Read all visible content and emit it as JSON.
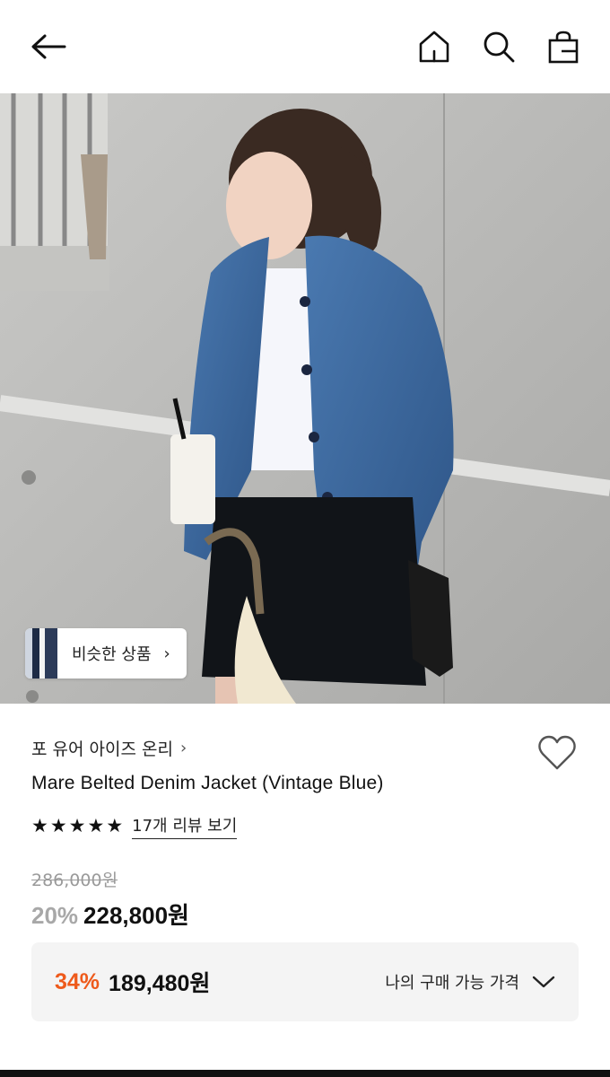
{
  "header": {
    "icons": [
      "back-arrow-icon",
      "home-icon",
      "search-icon",
      "shopping-bag-icon"
    ]
  },
  "hero": {
    "similar_products_label": "비슷한 상품"
  },
  "product": {
    "brand": "포 유어 아이즈 온리",
    "name": "Mare Belted Denim Jacket (Vintage Blue)",
    "rating_stars": 5,
    "review_link": "17개 리뷰 보기",
    "original_price": "286,000원",
    "sale_percent": "20%",
    "sale_price": "228,800원"
  },
  "my_price": {
    "percent": "34%",
    "price": "189,480원",
    "toggle_label": "나의 구매 가능 가격"
  },
  "colors": {
    "accent_orange": "#ee5a1b",
    "muted_gray": "#a8a8a8",
    "box_bg": "#f4f4f4"
  }
}
